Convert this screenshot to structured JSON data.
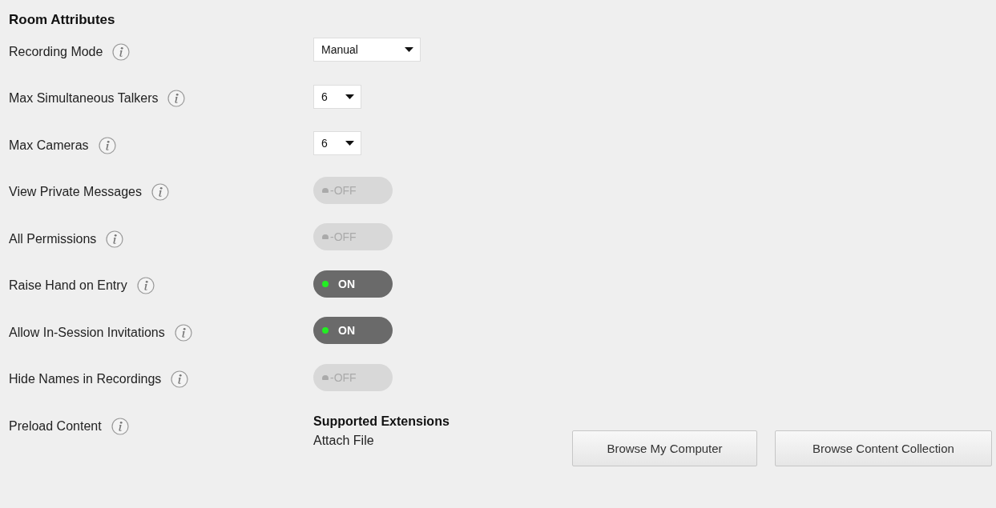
{
  "title": "Room Attributes",
  "rows": [
    {
      "label": "Recording Mode",
      "kind": "select",
      "value": "Manual",
      "wide": true
    },
    {
      "label": "Max Simultaneous Talkers",
      "kind": "select",
      "value": "6",
      "wide": false
    },
    {
      "label": "Max Cameras",
      "kind": "select",
      "value": "6",
      "wide": false
    },
    {
      "label": "View Private Messages",
      "kind": "toggle",
      "on": false,
      "text": "-OFF"
    },
    {
      "label": "All Permissions",
      "kind": "toggle",
      "on": false,
      "text": "-OFF"
    },
    {
      "label": "Raise Hand on Entry",
      "kind": "toggle",
      "on": true,
      "text": "ON"
    },
    {
      "label": "Allow In-Session Invitations",
      "kind": "toggle",
      "on": true,
      "text": "ON"
    },
    {
      "label": "Hide Names in Recordings",
      "kind": "toggle",
      "on": false,
      "text": "-OFF"
    },
    {
      "label": "Preload Content",
      "kind": "content",
      "heading": "Supported Extensions",
      "attach_label": "Attach File",
      "buttons": [
        "Browse My Computer",
        "Browse Content Collection"
      ]
    }
  ]
}
